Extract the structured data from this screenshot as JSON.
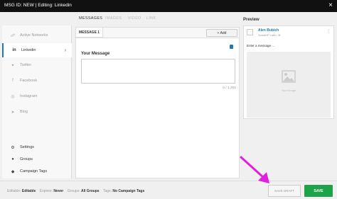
{
  "window": {
    "title": "MSG ID: NEW | Editing: Linkedin",
    "close": "×"
  },
  "sidebar": {
    "items": [
      {
        "label": "Active Networks",
        "icon": "share-icon",
        "glyph": "☍"
      },
      {
        "label": "Linkedin",
        "icon": "linkedin-icon",
        "glyph": "in",
        "chevron": "›"
      },
      {
        "label": "Twitter",
        "icon": "twitter-icon",
        "glyph": "✦"
      },
      {
        "label": "Facebook",
        "icon": "facebook-icon",
        "glyph": "f"
      },
      {
        "label": "Instagram",
        "icon": "instagram-icon",
        "glyph": "◎"
      },
      {
        "label": "Blog",
        "icon": "send-icon",
        "glyph": "➤"
      }
    ],
    "settings": [
      {
        "label": "Settings",
        "icon": "gear-icon",
        "glyph": "⚙"
      },
      {
        "label": "Groups",
        "icon": "users-icon",
        "glyph": "●"
      },
      {
        "label": "Campaign Tags",
        "icon": "tag-icon",
        "glyph": "◆"
      }
    ]
  },
  "tabs": [
    "MESSAGES",
    "IMAGES",
    "VIDEO",
    "LINK"
  ],
  "editor": {
    "message_tab": "MESSAGE 1",
    "add_label": "+ Add",
    "your_message": "Your Message",
    "counter": "0 / 1,300"
  },
  "preview": {
    "header": "Preview",
    "name": "Alen Bubich",
    "sub": "SocialHP Labs • ⊕",
    "menu": "⋮",
    "enter": "Enter a message ...",
    "your_image": "Your Image"
  },
  "footer": {
    "editable_label": "Editable:",
    "editable_value": "Editable",
    "expires_label": "Expires:",
    "expires_value": "Never",
    "groups_label": "Groups:",
    "groups_value": "All Groups",
    "tags_label": "Tags:",
    "tags_value": "No Campaign Tags",
    "save_draft": "SAVE DRAFT",
    "save": "SAVE"
  },
  "colors": {
    "accent": "#1d7ab8",
    "save": "#1fa34a",
    "arrow": "#e020e0",
    "titlebar": "#111111"
  }
}
